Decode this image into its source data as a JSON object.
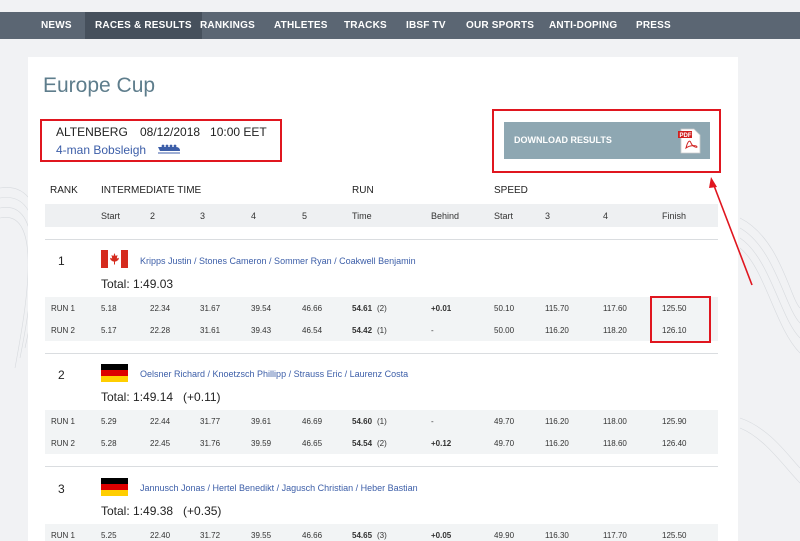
{
  "nav": {
    "items": [
      "NEWS",
      "RACES & RESULTS",
      "RANKINGS",
      "ATHLETES",
      "TRACKS",
      "IBSF TV",
      "OUR SPORTS",
      "ANTI-DOPING",
      "PRESS"
    ],
    "active": "RACES & RESULTS"
  },
  "page": {
    "title": "Europe Cup"
  },
  "race": {
    "city": "ALTENBERG",
    "datetime": "08/12/2018   10:00 EET",
    "discipline": "4-man Bobsleigh",
    "download_label": "DOWNLOAD RESULTS",
    "pdf_label": "PDF"
  },
  "headers": {
    "rank": "RANK",
    "intermediate": "INTERMEDIATE TIME",
    "run": "RUN",
    "speed": "SPEED",
    "sub": {
      "start": "Start",
      "i2": "2",
      "i3": "3",
      "i4": "4",
      "i5": "5",
      "time": "Time",
      "behind": "Behind",
      "sp_start": "Start",
      "sp3": "3",
      "sp4": "4",
      "finish": "Finish"
    }
  },
  "results": [
    {
      "rank": "1",
      "country": "CAN",
      "athletes": "Kripps Justin / Stones Cameron / Sommer Ryan / Coakwell Benjamin",
      "total": "Total: 1:49.03",
      "runs": [
        {
          "label": "RUN 1",
          "start": "5.18",
          "i2": "22.34",
          "i3": "31.67",
          "i4": "39.54",
          "i5": "46.66",
          "time": "54.61",
          "pos": "(2)",
          "behind": "+0.01",
          "sp_start": "50.10",
          "sp3": "115.70",
          "sp4": "117.60",
          "finish": "125.50"
        },
        {
          "label": "RUN 2",
          "start": "5.17",
          "i2": "22.28",
          "i3": "31.61",
          "i4": "39.43",
          "i5": "46.54",
          "time": "54.42",
          "pos": "(1)",
          "behind": "-",
          "sp_start": "50.00",
          "sp3": "116.20",
          "sp4": "118.20",
          "finish": "126.10"
        }
      ]
    },
    {
      "rank": "2",
      "country": "GER",
      "athletes": "Oelsner Richard / Knoetzsch Phillipp / Strauss Eric / Laurenz Costa",
      "total": "Total: 1:49.14   (+0.11)",
      "runs": [
        {
          "label": "RUN 1",
          "start": "5.29",
          "i2": "22.44",
          "i3": "31.77",
          "i4": "39.61",
          "i5": "46.69",
          "time": "54.60",
          "pos": "(1)",
          "behind": "-",
          "sp_start": "49.70",
          "sp3": "116.20",
          "sp4": "118.00",
          "finish": "125.90"
        },
        {
          "label": "RUN 2",
          "start": "5.28",
          "i2": "22.45",
          "i3": "31.76",
          "i4": "39.59",
          "i5": "46.65",
          "time": "54.54",
          "pos": "(2)",
          "behind": "+0.12",
          "sp_start": "49.70",
          "sp3": "116.20",
          "sp4": "118.60",
          "finish": "126.40"
        }
      ]
    },
    {
      "rank": "3",
      "country": "GER",
      "athletes": "Jannusch Jonas / Hertel Benedikt / Jagusch Christian / Heber Bastian",
      "total": "Total: 1:49.38   (+0.35)",
      "runs": [
        {
          "label": "RUN 1",
          "start": "5.25",
          "i2": "22.40",
          "i3": "31.72",
          "i4": "39.55",
          "i5": "46.66",
          "time": "54.65",
          "pos": "(3)",
          "behind": "+0.05",
          "sp_start": "49.90",
          "sp3": "116.30",
          "sp4": "117.70",
          "finish": "125.50"
        }
      ]
    }
  ],
  "colors": {
    "nav_bg": "#5b6673",
    "accent_link": "#3c5ea8",
    "title": "#5e7d8c",
    "download_btn": "#8ea7b2",
    "annotation_red": "#e0161f"
  }
}
